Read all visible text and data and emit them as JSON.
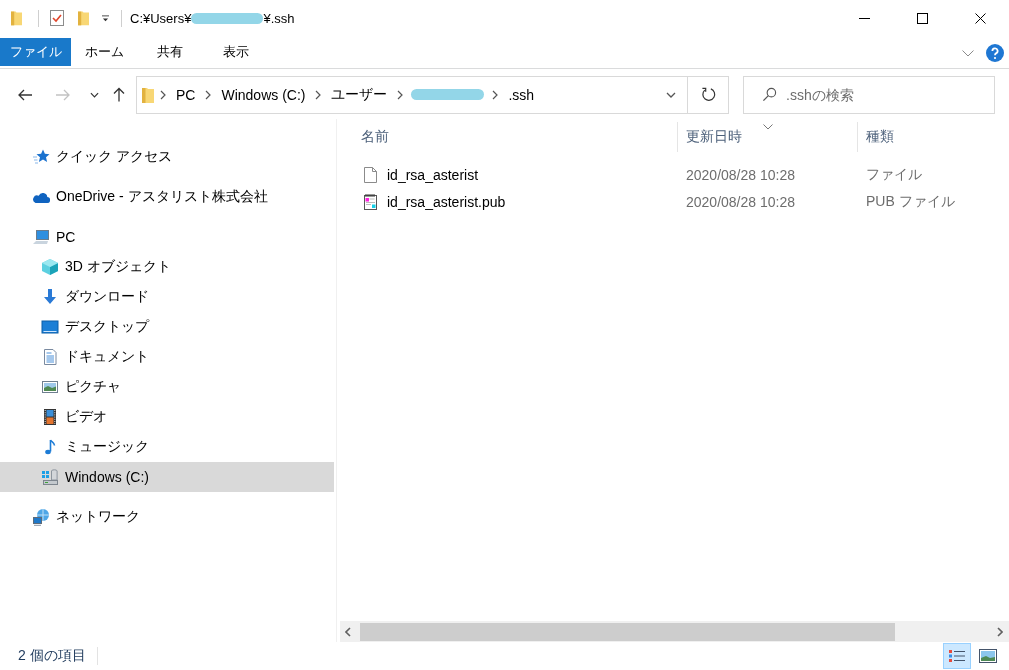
{
  "window": {
    "title_parts": [
      {
        "kind": "text",
        "text": "C:¥Users¥"
      },
      {
        "kind": "redacted"
      },
      {
        "kind": "text",
        "text": "¥.ssh"
      }
    ]
  },
  "ribbon": {
    "file_tab": "ファイル",
    "tabs": [
      "ホーム",
      "共有",
      "表示"
    ]
  },
  "navigation": {
    "buttons": [
      {
        "kind": "back",
        "disabled": false
      },
      {
        "kind": "forward",
        "disabled": true
      },
      {
        "kind": "recent",
        "disabled": false
      },
      {
        "kind": "up",
        "disabled": false
      }
    ],
    "breadcrumb": [
      {
        "kind": "text",
        "text": "PC"
      },
      {
        "kind": "text",
        "text": "Windows (C:)"
      },
      {
        "kind": "text",
        "text": "ユーザー"
      },
      {
        "kind": "redacted"
      },
      {
        "kind": "text",
        "text": ".ssh"
      }
    ],
    "search": {
      "placeholder": ".sshの検索"
    }
  },
  "sidebar": {
    "items": [
      {
        "kind": "quickaccess",
        "label": "クイック アクセス",
        "selected": false
      },
      {
        "kind": "cloud",
        "label": "OneDrive - アスタリスト株式会社",
        "selected": false
      },
      {
        "kind": "computer",
        "label": "PC",
        "selected": false,
        "children": [
          {
            "kind": "objects",
            "label": "3D オブジェクト",
            "selected": false
          },
          {
            "kind": "downloads",
            "label": "ダウンロード",
            "selected": false
          },
          {
            "kind": "desktop",
            "label": "デスクトップ",
            "selected": false
          },
          {
            "kind": "documents",
            "label": "ドキュメント",
            "selected": false
          },
          {
            "kind": "pictures",
            "label": "ピクチャ",
            "selected": false
          },
          {
            "kind": "videos",
            "label": "ビデオ",
            "selected": false
          },
          {
            "kind": "music",
            "label": "ミュージック",
            "selected": false
          },
          {
            "kind": "drive",
            "label": "Windows (C:)",
            "selected": true
          }
        ]
      },
      {
        "kind": "network",
        "label": "ネットワーク",
        "selected": false
      }
    ]
  },
  "file_list": {
    "columns": [
      {
        "label": "名前",
        "sorted": false
      },
      {
        "label": "更新日時",
        "sorted": true
      },
      {
        "label": "種類",
        "sorted": false
      }
    ],
    "rows": [
      {
        "kind": "plain",
        "name": "id_rsa_asterist",
        "modified": "2020/08/28 10:28",
        "type": "ファイル",
        "selected": false
      },
      {
        "kind": "pub",
        "name": "id_rsa_asterist.pub",
        "modified": "2020/08/28 10:28",
        "type": "PUB ファイル",
        "selected": false
      }
    ]
  },
  "status_bar": {
    "item_count": "2 個の項目",
    "views": [
      {
        "kind": "details",
        "selected": true
      },
      {
        "kind": "icons",
        "selected": false
      }
    ]
  }
}
